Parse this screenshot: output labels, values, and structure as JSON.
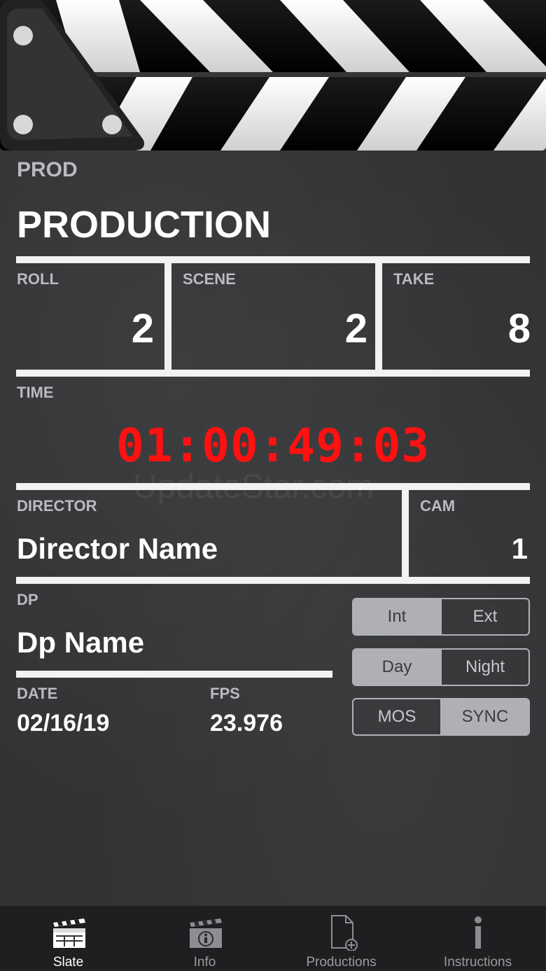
{
  "slate": {
    "prod_label": "PROD",
    "production": "PRODUCTION",
    "roll_label": "ROLL",
    "roll_value": "2",
    "scene_label": "SCENE",
    "scene_value": "2",
    "take_label": "TAKE",
    "take_value": "8",
    "time_label": "TIME",
    "timecode": "01:00:49:03",
    "director_label": "DIRECTOR",
    "director_value": "Director Name",
    "cam_label": "CAM",
    "cam_value": "1",
    "dp_label": "DP",
    "dp_value": "Dp Name",
    "date_label": "DATE",
    "date_value": "02/16/19",
    "fps_label": "FPS",
    "fps_value": "23.976",
    "watermark": "UpdateStar.com"
  },
  "toggles": {
    "location": {
      "options": [
        "Int",
        "Ext"
      ],
      "selected": "Int"
    },
    "daytime": {
      "options": [
        "Day",
        "Night"
      ],
      "selected": "Day"
    },
    "sound": {
      "options": [
        "MOS",
        "SYNC"
      ],
      "selected": "SYNC"
    }
  },
  "tabs": [
    {
      "label": "Slate",
      "icon": "clapperboard-icon",
      "active": true
    },
    {
      "label": "Info",
      "icon": "info-clapper-icon",
      "active": false
    },
    {
      "label": "Productions",
      "icon": "add-document-icon",
      "active": false
    },
    {
      "label": "Instructions",
      "icon": "info-i-icon",
      "active": false
    }
  ],
  "colors": {
    "board": "#323335",
    "timecode": "#ff1111",
    "tabbar": "#1f1f21"
  }
}
